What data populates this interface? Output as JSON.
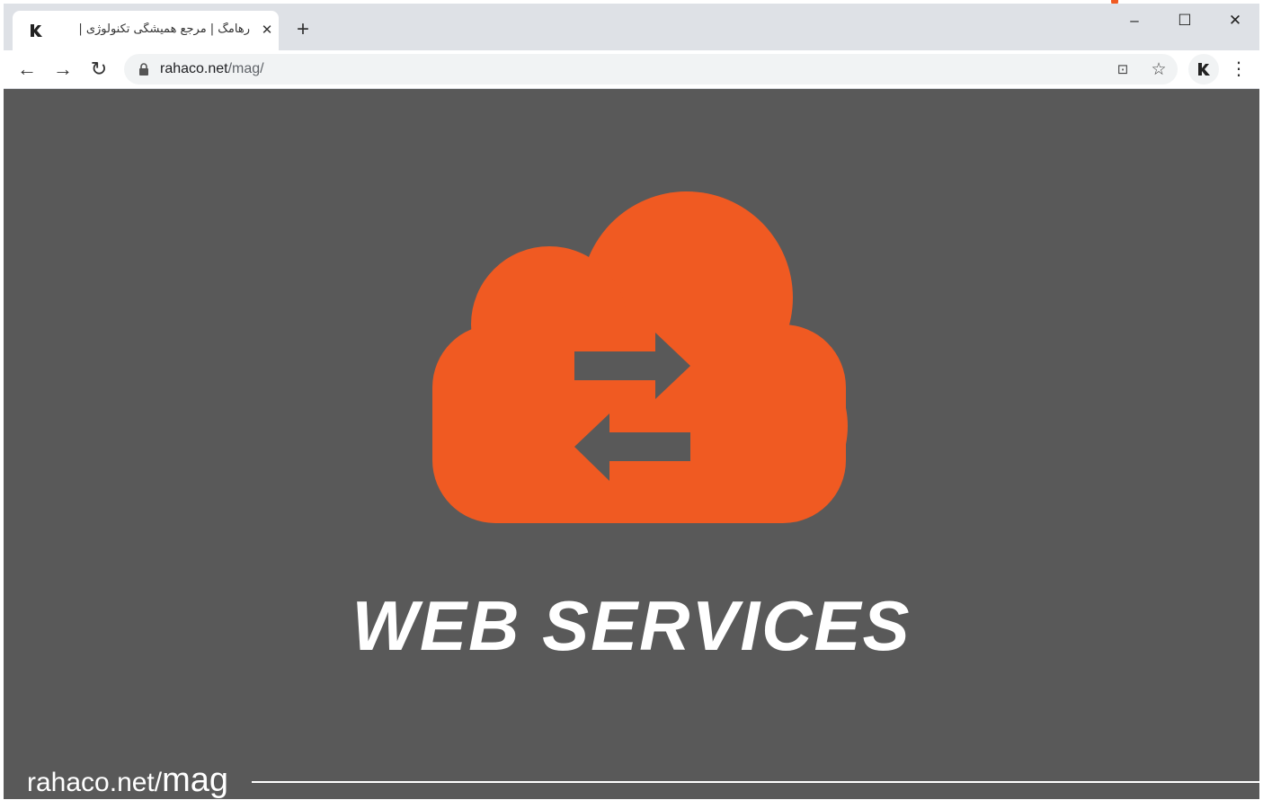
{
  "browser": {
    "tab": {
      "title": "رهامگ | مرجع همیشگی تکنولوژی |",
      "close_label": "✕"
    },
    "new_tab_label": "+",
    "window_controls": {
      "minimize": "–",
      "maximize": "☐",
      "close": "✕"
    },
    "toolbar": {
      "back": "←",
      "forward": "→",
      "reload": "↻",
      "url_host": "rahaco.net",
      "url_path": "/mag/",
      "icons": [
        "lock-icon",
        "translate-icon",
        "bookmark-star-icon",
        "rahaco-extension-icon",
        "menu-icon"
      ],
      "star_label": "☆",
      "menu_label": "⋮",
      "translate_label": "⊡"
    }
  },
  "page": {
    "background_color": "#595959",
    "accent_color": "#f05a22",
    "hero_icon": "cloud-sync-icon",
    "title": "WEB SERVICES",
    "footer": {
      "site": "rahaco.net/",
      "section": "mag"
    }
  }
}
